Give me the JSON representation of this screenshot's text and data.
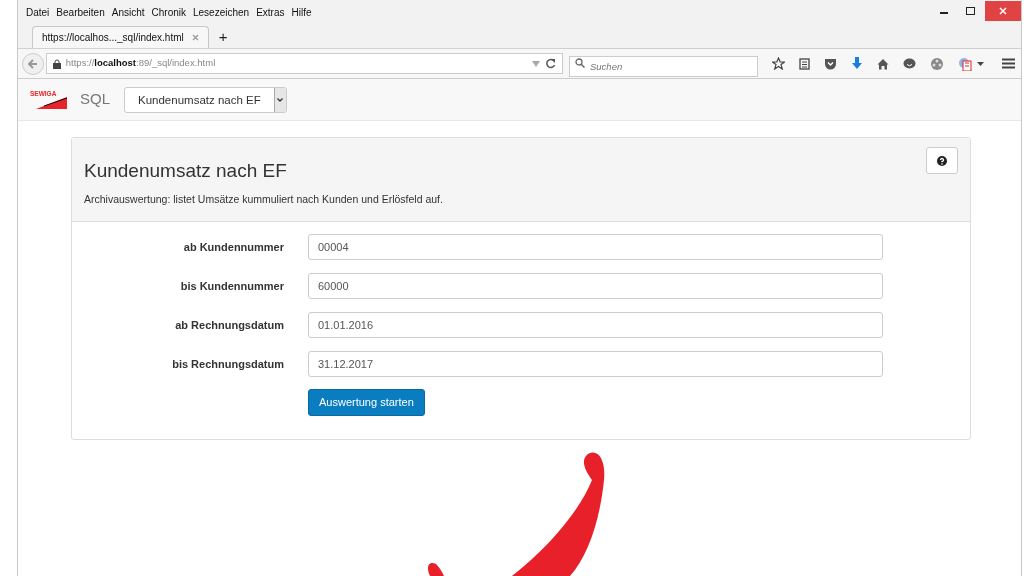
{
  "menu": [
    "Datei",
    "Bearbeiten",
    "Ansicht",
    "Chronik",
    "Lesezeichen",
    "Extras",
    "Hilfe"
  ],
  "tabs": [
    {
      "label": "https://localhos..._sql/index.html",
      "selected": true
    }
  ],
  "new_tab": "+",
  "address": {
    "prefix": "https://",
    "host": "localhost",
    "rest": ":89/_sql/index.html"
  },
  "search": {
    "placeholder": "Suchen"
  },
  "app": {
    "logo": "SEWIGA",
    "title": "SQL",
    "report_select": "Kundenumsatz nach EF"
  },
  "panel": {
    "title": "Kundenumsatz nach EF",
    "description": "Archivauswertung: listet Umsätze kummuliert nach Kunden und Erlösfeld auf.",
    "fields": [
      {
        "label": "ab Kundennummer",
        "value": "00004"
      },
      {
        "label": "bis Kundennummer",
        "value": "60000"
      },
      {
        "label": "ab Rechnungsdatum",
        "value": "01.01.2016"
      },
      {
        "label": "bis Rechnungsdatum",
        "value": "31.12.2017"
      }
    ],
    "submit": "Auswertung starten"
  }
}
